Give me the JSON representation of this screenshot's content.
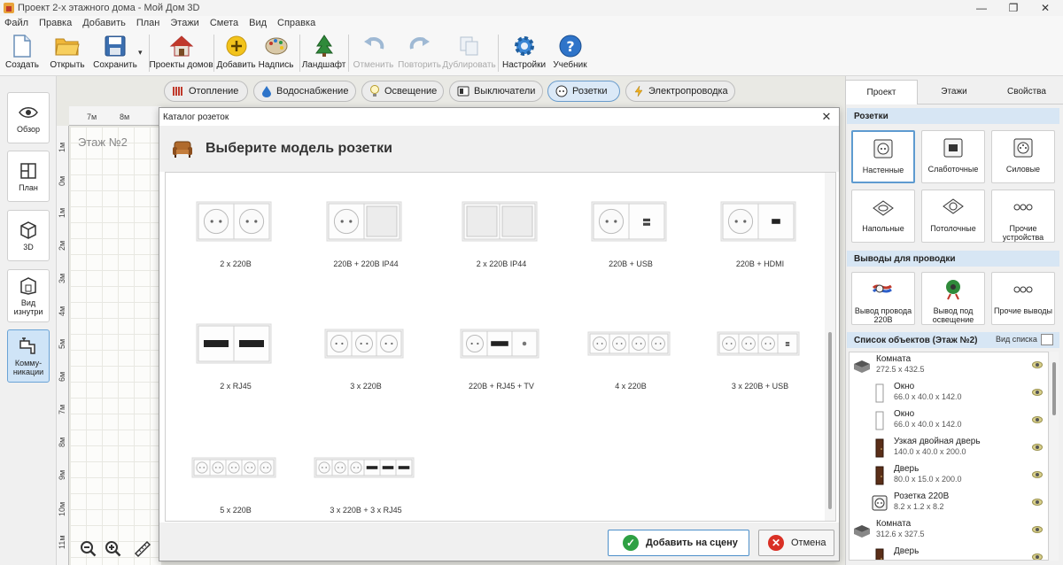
{
  "window": {
    "title": "Проект 2-х этажного дома - Мой Дом 3D",
    "minimize": "—",
    "restore": "❐",
    "close": "✕"
  },
  "menu": [
    "Файл",
    "Правка",
    "Добавить",
    "План",
    "Этажи",
    "Смета",
    "Вид",
    "Справка"
  ],
  "toolbar": {
    "create": "Создать",
    "open": "Открыть",
    "save": "Сохранить",
    "save_dropdown": "▾",
    "projects": "Проекты домов",
    "add": "Добавить",
    "label": "Надпись",
    "landscape": "Ландшафт",
    "undo": "Отменить",
    "redo": "Повторить",
    "duplicate": "Дублировать",
    "settings": "Настройки",
    "tutorial": "Учебник"
  },
  "left_nav": {
    "overview": "Обзор",
    "plan": "План",
    "view3d": "3D",
    "inside_view": "Вид изнутри",
    "communications": "Комму-никации"
  },
  "categories": [
    "Отопление",
    "Водоснабжение",
    "Освещение",
    "Выключатели",
    "Розетки",
    "Электропроводка"
  ],
  "canvas": {
    "floor_label": "Этаж №2",
    "ruler_top": [
      "7м",
      "8м"
    ],
    "ruler_left": [
      "1м",
      "0м",
      "1м",
      "2м",
      "3м",
      "4м",
      "5м",
      "6м",
      "7м",
      "8м",
      "9м",
      "10м",
      "11м"
    ]
  },
  "right_panel": {
    "tabs": [
      "Проект",
      "Этажи",
      "Свойства"
    ],
    "sockets_header": "Розетки",
    "socket_types": [
      "Настенные",
      "Слаботочные",
      "Силовые",
      "Напольные",
      "Потолочные",
      "Прочие устройства"
    ],
    "outputs_header": "Выводы для проводки",
    "outputs": [
      "Вывод провода 220В",
      "Вывод под освещение",
      "Прочие выводы"
    ],
    "list_header": "Список объектов (Этаж №2)",
    "list_view": "Вид списка",
    "objects": [
      {
        "name": "Комната",
        "dims": "272.5 x 432.5",
        "indent": 0,
        "icon": "room"
      },
      {
        "name": "Окно",
        "dims": "66.0 x 40.0 x 142.0",
        "indent": 1,
        "icon": "window"
      },
      {
        "name": "Окно",
        "dims": "66.0 x 40.0 x 142.0",
        "indent": 1,
        "icon": "window"
      },
      {
        "name": "Узкая двойная дверь",
        "dims": "140.0 x 40.0 x 200.0",
        "indent": 1,
        "icon": "door"
      },
      {
        "name": "Дверь",
        "dims": "80.0 x 15.0 x 200.0",
        "indent": 1,
        "icon": "door"
      },
      {
        "name": "Розетка 220В",
        "dims": "8.2 x 1.2 x 8.2",
        "indent": 1,
        "icon": "socket"
      },
      {
        "name": "Комната",
        "dims": "312.6 x 327.5",
        "indent": 0,
        "icon": "room"
      },
      {
        "name": "Дверь",
        "dims": "",
        "indent": 1,
        "icon": "door"
      }
    ]
  },
  "dialog": {
    "title": "Каталог розеток",
    "close": "✕",
    "heading": "Выберите модель розетки",
    "models": [
      "2 x 220В",
      "220В + 220В IP44",
      "2 x 220В IP44",
      "220В + USB",
      "220В + HDMI",
      "2 x RJ45",
      "3 x 220В",
      "220В + RJ45 + TV",
      "4 x 220В",
      "3 x 220В + USB",
      "5 x 220В",
      "3 x 220В + 3 x RJ45"
    ],
    "add_button": "Добавить на сцену",
    "cancel_button": "Отмена"
  }
}
